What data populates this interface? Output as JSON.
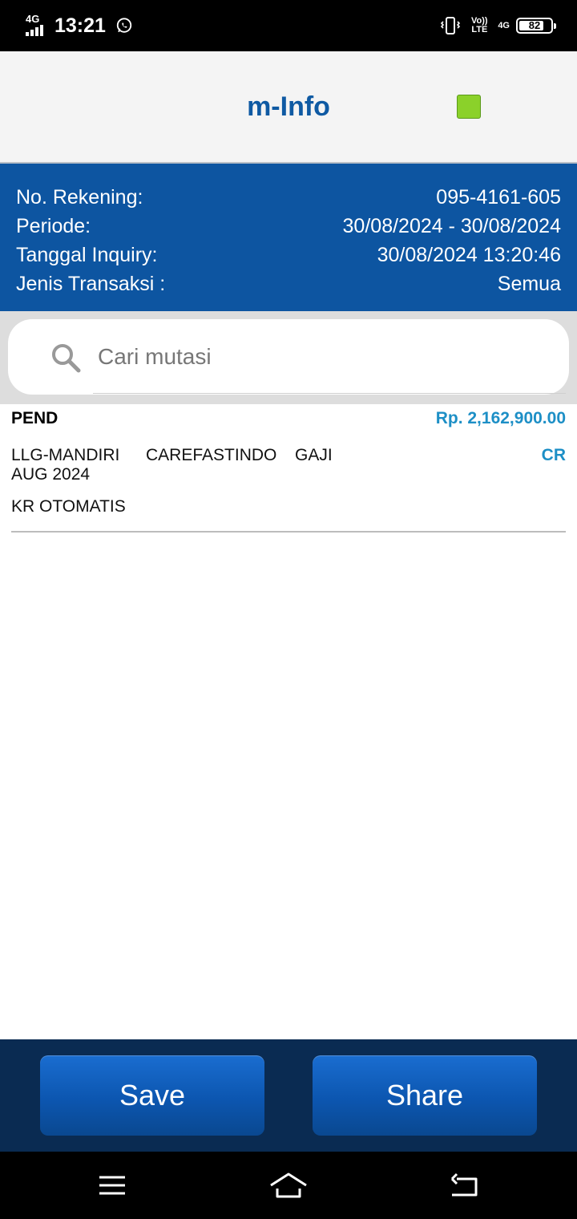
{
  "status_bar": {
    "network": "4G",
    "time": "13:21",
    "volte": "Vo)) LTE",
    "network_right": "4G",
    "battery": "82",
    "battery_level_percent": 82,
    "icons": [
      "signal-icon",
      "whatsapp-icon",
      "vibrate-icon",
      "battery-icon"
    ]
  },
  "header": {
    "title": "m-Info",
    "indicator_color": "#8bd12a"
  },
  "info": {
    "rows": [
      {
        "label": "No. Rekening:",
        "value": "095-4161-605"
      },
      {
        "label": "Periode:",
        "value": "30/08/2024 - 30/08/2024"
      },
      {
        "label": "Tanggal Inquiry:",
        "value": "30/08/2024 13:20:46"
      },
      {
        "label": "Jenis Transaksi :",
        "value": "Semua"
      }
    ]
  },
  "search": {
    "placeholder": "Cari mutasi"
  },
  "transactions": [
    {
      "status": "PEND",
      "amount": "Rp. 2,162,900.00",
      "desc_parts": [
        "LLG-MANDIRI",
        "CAREFASTINDO",
        "GAJI"
      ],
      "desc_line2": "AUG 2024",
      "desc_line3": "KR OTOMATIS",
      "type": "CR"
    }
  ],
  "actions": {
    "save_label": "Save",
    "share_label": "Share"
  },
  "colors": {
    "primary_blue": "#0d55a1",
    "title_blue": "#0f5aa3",
    "amount_blue": "#1d8fc6",
    "action_bar": "#0a2b52"
  },
  "nav": {
    "icons": [
      "menu-icon",
      "home-icon",
      "back-icon"
    ]
  }
}
